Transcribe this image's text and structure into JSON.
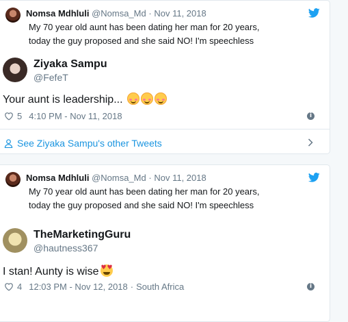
{
  "cards": [
    {
      "quote": {
        "name": "Nomsa Mdhluli",
        "handle": "@Nomsa_Md",
        "date": "Nov 11, 2018",
        "text": "My 70 year old aunt has been dating her man for 20 years, today the guy proposed and she said NO! I'm speechless"
      },
      "author": {
        "name": "Ziyaka Sampu",
        "handle": "@FefeT"
      },
      "text": "Your aunt is leadership...",
      "emoji": [
        "blush",
        "blush",
        "blush"
      ],
      "likes": "5",
      "time": "4:10 PM - Nov 11, 2018",
      "see_other": "See Ziyaka Sampu's other Tweets"
    },
    {
      "quote": {
        "name": "Nomsa Mdhluli",
        "handle": "@Nomsa_Md",
        "date": "Nov 11, 2018",
        "text": "My 70 year old aunt has been dating her man for 20 years, today the guy proposed and she said NO! I'm speechless"
      },
      "author": {
        "name": "TheMarketingGuru",
        "handle": "@hautness367"
      },
      "text": "I stan! Aunty is wise",
      "emoji": [
        "heart-eyes"
      ],
      "likes": "4",
      "time": "12:03 PM - Nov 12, 2018",
      "location": "South Africa"
    }
  ],
  "colors": {
    "link": "#1b95e0",
    "twitter_bird": "#1da1f2",
    "meta": "#657786"
  }
}
